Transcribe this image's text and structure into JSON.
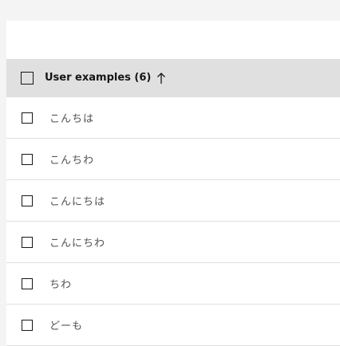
{
  "table": {
    "header": {
      "label": "User examples (6)",
      "sort_icon": "arrow-up-icon"
    },
    "rows": [
      {
        "text": "こんちは"
      },
      {
        "text": "こんちわ"
      },
      {
        "text": "こんにちは"
      },
      {
        "text": "こんにちわ"
      },
      {
        "text": "ちわ"
      },
      {
        "text": "どーも"
      }
    ]
  },
  "colors": {
    "page_background": "#f4f4f4",
    "header_background": "#e0e0e0",
    "row_background": "#ffffff",
    "text_primary": "#161616",
    "text_secondary": "#525252"
  }
}
